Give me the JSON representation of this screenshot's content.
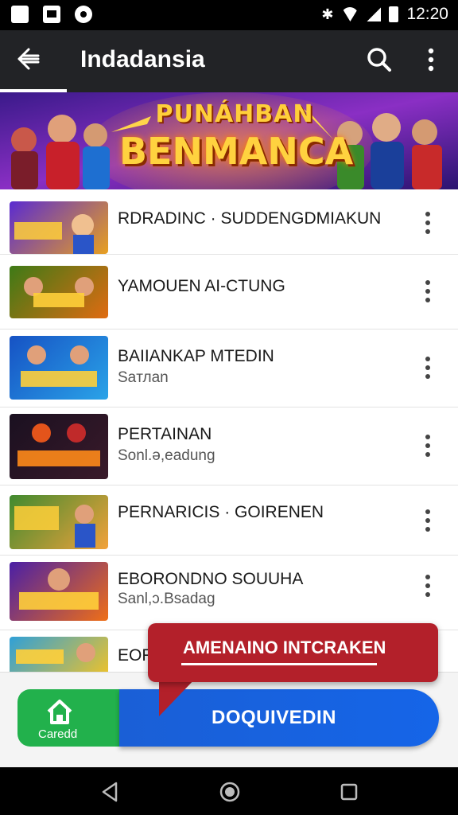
{
  "status_bar": {
    "time": "12:20",
    "left_icons": [
      "notification-app-icon",
      "image-icon",
      "settings-icon"
    ],
    "right_icons": [
      "bluetooth-icon",
      "wifi-icon",
      "signal-icon",
      "battery-icon"
    ]
  },
  "app_bar": {
    "title": "Indadansia",
    "icons": [
      "back-arrow-icon",
      "search-icon",
      "more-vert-icon"
    ]
  },
  "banner": {
    "line1": "PUNÁHBAN",
    "line2": "BENMANCA"
  },
  "list": {
    "items": [
      {
        "title": "RDRADINC · SUDDENGDMIAKUN",
        "subtitle": "",
        "thumb_colors": [
          "#5a2bd1",
          "#e8a020"
        ]
      },
      {
        "title": "YAMOUEN AI-CTUNG",
        "subtitle": "",
        "thumb_colors": [
          "#3d7a16",
          "#e06b12"
        ]
      },
      {
        "title": "BAIIANKAP MTEDIN",
        "subtitle": "Saтлan",
        "thumb_colors": [
          "#1652c4",
          "#2aa3e8"
        ]
      },
      {
        "title": "PERTAINAN",
        "subtitle": "Sonl.ə,eadung",
        "thumb_colors": [
          "#1a1020",
          "#e3541b"
        ]
      },
      {
        "title": "PERNARICIS · GOIRENEN",
        "subtitle": "",
        "thumb_colors": [
          "#3f8a2f",
          "#f2a23b"
        ]
      },
      {
        "title": "EBORONDNO SOUUHA",
        "subtitle": "Sanl,ɔ.Bsadag",
        "thumb_colors": [
          "#4a1fa6",
          "#ef6f17"
        ]
      },
      {
        "title": "EOR",
        "subtitle": "",
        "thumb_colors": [
          "#2fa0d8",
          "#e8c130"
        ]
      }
    ]
  },
  "tooltip": {
    "text": "AMENAINO INTCRAKEN"
  },
  "bottom_actions": {
    "home_label": "Caredd",
    "primary_label": "DOQUIVEDIN",
    "colors": {
      "home": "#22b14c",
      "primary": "#1a5fd6",
      "tooltip": "#b3202a"
    }
  },
  "nav_bar": {
    "icons": [
      "nav-back-icon",
      "nav-home-icon",
      "nav-recents-icon"
    ]
  }
}
